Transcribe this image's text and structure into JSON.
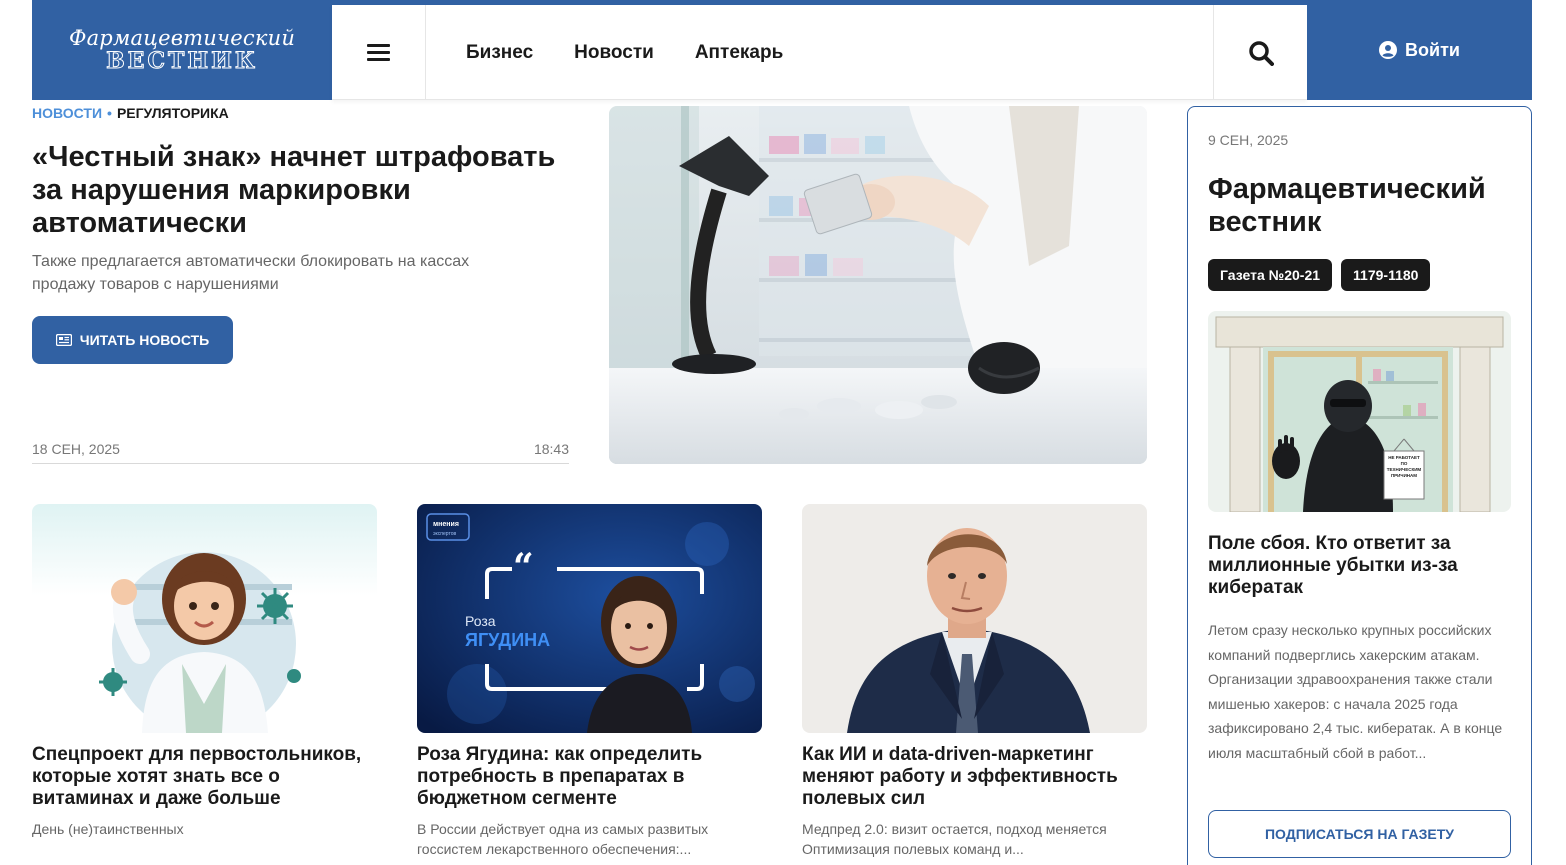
{
  "header": {
    "logo_line1": "Фармацевтический",
    "logo_line2": "ВЕСТНИК",
    "menu_icon": "hamburger-icon",
    "nav": [
      "Бизнес",
      "Новости",
      "Аптекарь"
    ],
    "search_icon": "search-icon",
    "login_icon": "user-circle-icon",
    "login_label": "Войти",
    "brand_color": "#3161a3"
  },
  "hero": {
    "breadcrumb_section": "НОВОСТИ",
    "breadcrumb_category": "РЕГУЛЯТОРИКА",
    "title": "«Честный знак» начнет штрафовать за нарушения маркировки автоматически",
    "lead": "Также предлагается автоматически блокировать на кассах продажу товаров с нарушениями",
    "button_label": "ЧИТАТЬ НОВОСТЬ",
    "button_icon": "newspaper-icon",
    "date": "18 СЕН, 2025",
    "time": "18:43"
  },
  "cards": [
    {
      "title": "Спецпроект для первостольников, которые хотят знать все о витаминах и даже больше",
      "lead": "День (не)таинственных"
    },
    {
      "title": "Роза Ягудина: как определить потребность в препаратах в бюджетном сегменте",
      "lead": "В России действует одна из самых развитых госсистем лекарственного обеспечения:...",
      "image_badge_line1": "мнения",
      "image_badge_line2": "экспертов",
      "image_name_first": "Роза",
      "image_name_last": "ЯГУДИНА"
    },
    {
      "title": "Как ИИ и data-driven-маркетинг меняют работу и эффективность полевых сил",
      "lead": "Медпред 2.0: визит остается, подход меняется Оптимизация полевых команд и..."
    }
  ],
  "sidebar": {
    "date": "9 СЕН, 2025",
    "title": "Фармацевтический вестник",
    "badges": [
      "Газета №20-21",
      "1179-1180"
    ],
    "image_sign": "НЕ РАБОТАЕТ ПО ТЕХНИЧЕСКИМ ПРИЧИНАМ",
    "article_title": "Поле сбоя. Кто ответит за миллионные убытки из-за кибератак",
    "article_lead": "Летом сразу несколько крупных российских компаний подверглись хакерским атакам. Организации здравоохранения также стали мишенью хакеров: с начала 2025 года зафиксировано 2,4 тыс. кибератак. А в конце июля масштабный сбой в работ...",
    "subscribe_label": "ПОДПИСАТЬСЯ НА ГАЗЕТУ"
  }
}
